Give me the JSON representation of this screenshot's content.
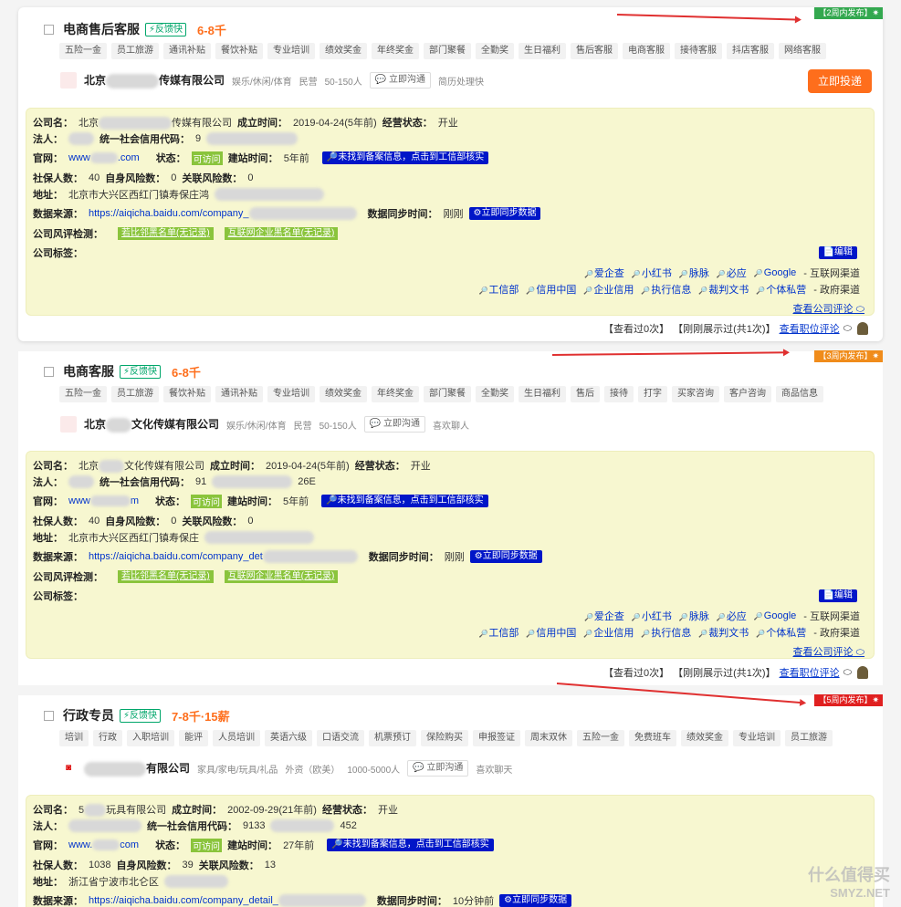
{
  "common": {
    "labels": {
      "company_name": "公司名：",
      "founded": "成立时间：",
      "status": "经营状态：",
      "legal": "法人：",
      "credit_code": "统一社会信用代码：",
      "website": "官网：",
      "site_status": "状态：",
      "site_age": "建站时间：",
      "insured": "社保人数：",
      "self_risk": "自身风险数：",
      "related_risk": "关联风险数：",
      "address": "地址：",
      "data_source": "数据来源：",
      "sync_time": "数据同步时间：",
      "risk_check": "公司风评检测：",
      "company_tags": "公司标签："
    },
    "site_accessible": "可访问",
    "icp_button": "🔎未找到备案信息，点击到工信部核实",
    "sync_button": "⚙立即同步数据",
    "risk_tags": [
      "若比邻黑名单(无记录)",
      "互联网企业黑名单(无记录)"
    ],
    "edit_button": "📄编辑",
    "internet_channels": [
      "爱企查",
      "小红书",
      "脉脉",
      "必应",
      "Google"
    ],
    "internet_channel_label": "- 互联网渠道",
    "gov_channels": [
      "工信部",
      "信用中国",
      "企业信用",
      "执行信息",
      "裁判文书",
      "个体私营"
    ],
    "gov_channel_label": "- 政府渠道",
    "company_review": "查看公司评论",
    "viewed": "【查看过0次】",
    "shown": "【刚刚展示过(共1次)】",
    "job_review": "查看职位评论",
    "fast_tag": "⚡反馈快",
    "chat_btn": "立即沟通"
  },
  "jobs": [
    {
      "title": "电商售后客服",
      "salary": "6-8千",
      "publish_badge": "【2周内发布】✷",
      "welfare": [
        "五险一金",
        "员工旅游",
        "通讯补贴",
        "餐饮补贴",
        "专业培训",
        "绩效奖金",
        "年终奖金",
        "部门聚餐",
        "全勤奖",
        "生日福利",
        "售后客服",
        "电商客服",
        "接待客服",
        "抖店客服",
        "网络客服"
      ],
      "company_prefix": "北京",
      "company_suffix": "传媒有限公司",
      "industry": "娱乐/休闲/体育",
      "ownership": "民营",
      "size": "50-150人",
      "hr_status": "简历处理快",
      "apply": "立即投递",
      "info": {
        "name": "北京",
        "name_suffix": "传媒有限公司",
        "founded": "2019-04-24(5年前)",
        "status": "开业",
        "credit": "9",
        "website": "www",
        "website_suffix": ".com",
        "site_age": "5年前",
        "insured": "40",
        "self_risk": "0",
        "related_risk": "0",
        "address": "北京市大兴区西红门镇寿保庄鸿",
        "data_source": "https://aiqicha.baidu.com/company_",
        "sync_time": "刚刚"
      }
    },
    {
      "title": "电商客服",
      "salary": "6-8千",
      "publish_badge": "【3周内发布】✷",
      "welfare": [
        "五险一金",
        "员工旅游",
        "餐饮补贴",
        "通讯补贴",
        "专业培训",
        "绩效奖金",
        "年终奖金",
        "部门聚餐",
        "全勤奖",
        "生日福利",
        "售后",
        "接待",
        "打字",
        "买家咨询",
        "客户咨询",
        "商品信息"
      ],
      "company_prefix": "北京",
      "company_suffix": "文化传媒有限公司",
      "industry": "娱乐/休闲/体育",
      "ownership": "民营",
      "size": "50-150人",
      "hr_status": "喜欢聊人",
      "info": {
        "name": "北京",
        "name_suffix": "文化传媒有限公司",
        "founded": "2019-04-24(5年前)",
        "status": "开业",
        "credit": "91",
        "credit_suffix": "26E",
        "website": "www",
        "website_suffix": "m",
        "site_age": "5年前",
        "insured": "40",
        "self_risk": "0",
        "related_risk": "0",
        "address": "北京市大兴区西红门镇寿保庄",
        "data_source": "https://aiqicha.baidu.com/company_det",
        "sync_time": "刚刚"
      }
    },
    {
      "title": "行政专员",
      "salary": "7-8千·15薪",
      "publish_badge": "【5周内发布】✷",
      "welfare": [
        "培训",
        "行政",
        "入职培训",
        "能评",
        "人员培训",
        "英语六级",
        "口语交流",
        "机票预订",
        "保险购买",
        "申报签证",
        "周末双休",
        "五险一金",
        "免费班车",
        "绩效奖金",
        "专业培训",
        "员工旅游"
      ],
      "company_prefix": "",
      "company_suffix": "有限公司",
      "industry": "家具/家电/玩具/礼品",
      "ownership": "外资（欧美）",
      "size": "1000-5000人",
      "hr_status": "喜欢聊天",
      "info": {
        "name": "5",
        "name_suffix": "玩具有限公司",
        "founded": "2002-09-29(21年前)",
        "status": "开业",
        "credit": "9133",
        "credit_suffix": "452",
        "website": "www.",
        "website_suffix": "com",
        "site_age": "27年前",
        "insured": "1038",
        "self_risk": "39",
        "related_risk": "13",
        "address": "浙江省宁波市北仑区",
        "data_source": "https://aiqicha.baidu.com/company_detail_",
        "sync_time": "10分钟前"
      }
    }
  ],
  "watermark": {
    "text": "什么值得买",
    "sub": "SMYZ.NET"
  }
}
